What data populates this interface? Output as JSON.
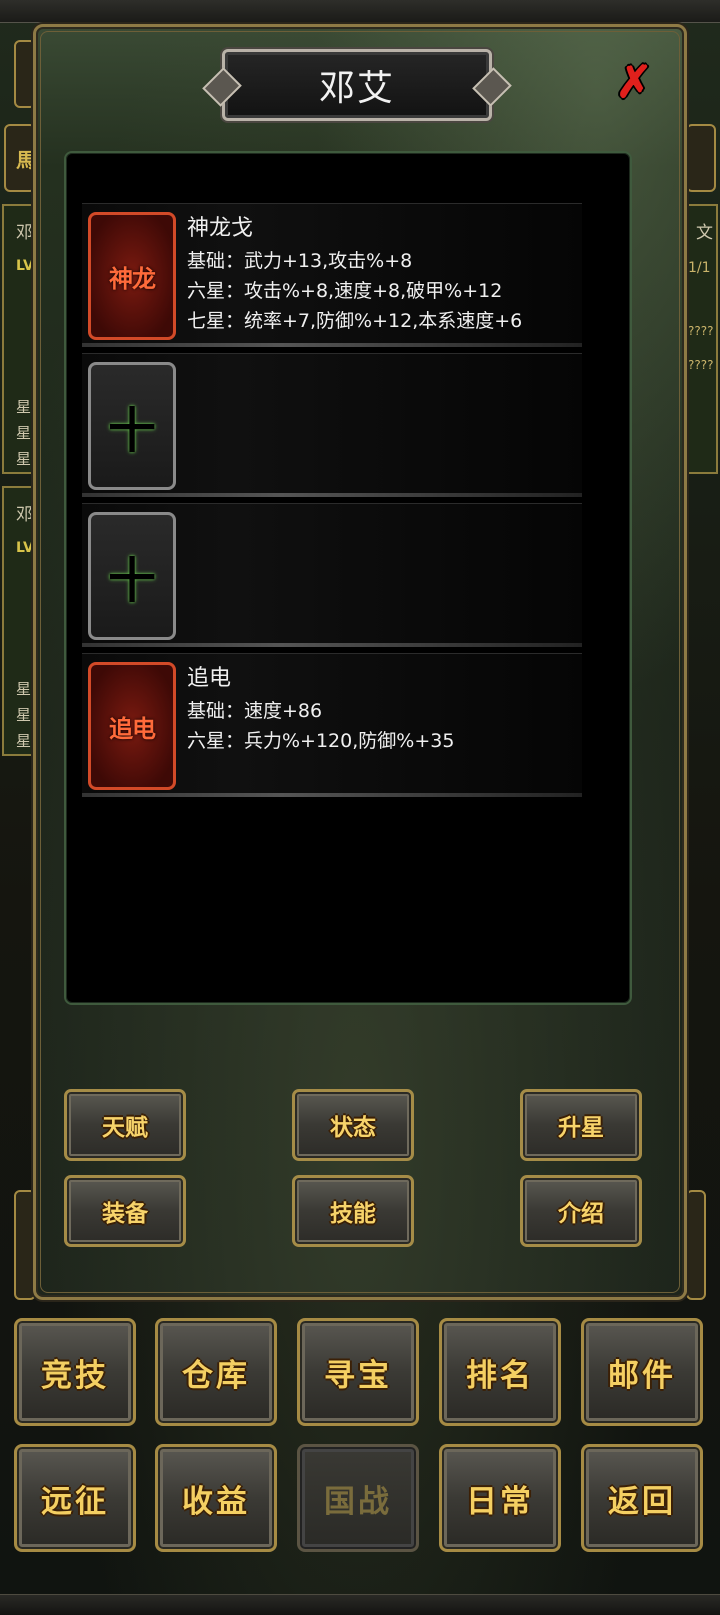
{
  "background": {
    "left_cards": [
      {
        "name": "邓",
        "level": "LV",
        "stars": [
          "星",
          "星",
          "星"
        ]
      },
      {
        "name": "邓",
        "level": "LV",
        "stars": [
          "星",
          "星",
          "星"
        ]
      }
    ],
    "right_card": {
      "name_fragment": "文",
      "count": "1/1",
      "mask_1": "????",
      "mask_2": "????"
    },
    "left_chip": "馬"
  },
  "modal": {
    "title": "邓艾",
    "close_icon": "close-x-icon",
    "equipment": [
      {
        "slot": "weapon",
        "filled": true,
        "icon_text": "神龙",
        "name": "神龙戈",
        "lines": [
          "基础：武力+13,攻击%+8",
          "六星：攻击%+8,速度+8,破甲%+12",
          "七星：统率+7,防御%+12,本系速度+6"
        ]
      },
      {
        "slot": "armor",
        "filled": false,
        "icon": "plus-icon"
      },
      {
        "slot": "treasure",
        "filled": false,
        "icon": "plus-icon"
      },
      {
        "slot": "mount",
        "filled": true,
        "icon_text": "追电",
        "name": "追电",
        "lines": [
          "基础：速度+86",
          "六星：兵力%+120,防御%+35"
        ]
      }
    ],
    "buttons": {
      "talent": "天赋",
      "status": "状态",
      "star_up": "升星",
      "equip": "装备",
      "skill": "技能",
      "intro": "介绍"
    }
  },
  "bottom_nav": {
    "row1": [
      "竞技",
      "仓库",
      "寻宝",
      "排名",
      "邮件"
    ],
    "row2": [
      "远征",
      "收益",
      "国战",
      "日常",
      "返回"
    ],
    "disabled": "国战"
  },
  "colors": {
    "gold_text": "#f4cf62",
    "frame_gold": "#a68b44",
    "close_red": "#e0201c",
    "item_red_border": "#d24a28"
  }
}
